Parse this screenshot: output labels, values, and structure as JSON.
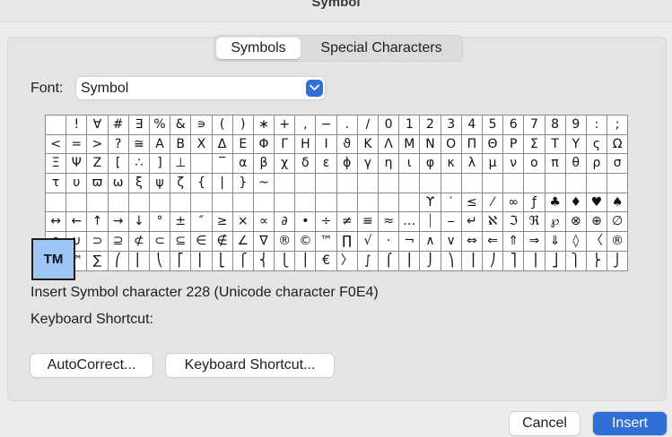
{
  "window": {
    "title": "Symbol"
  },
  "tabs": [
    {
      "label": "Symbols",
      "active": true
    },
    {
      "label": "Special Characters",
      "active": false
    }
  ],
  "font": {
    "label": "Font:",
    "value": "Symbol"
  },
  "grid": {
    "rows": [
      [
        "",
        "!",
        "∀",
        "#",
        "∃",
        "%",
        "&",
        "∍",
        "(",
        ")",
        "∗",
        "+",
        ",",
        "−",
        ".",
        "/",
        "0",
        "1",
        "2",
        "3",
        "4",
        "5",
        "6",
        "7",
        "8",
        "9",
        ":",
        ";"
      ],
      [
        "<",
        "=",
        ">",
        "?",
        "≅",
        "Α",
        "Β",
        "Χ",
        "Δ",
        "Ε",
        "Φ",
        "Γ",
        "Η",
        "Ι",
        "ϑ",
        "Κ",
        "Λ",
        "Μ",
        "Ν",
        "Ο",
        "Π",
        "Θ",
        "Ρ",
        "Σ",
        "Τ",
        "Υ",
        "ς",
        "Ω"
      ],
      [
        "Ξ",
        "Ψ",
        "Ζ",
        "[",
        "∴",
        "]",
        "⊥",
        "",
        "‾",
        "α",
        "β",
        "χ",
        "δ",
        "ε",
        "ϕ",
        "γ",
        "η",
        "ι",
        "φ",
        "κ",
        "λ",
        "μ",
        "ν",
        "ο",
        "π",
        "θ",
        "ρ",
        "σ"
      ],
      [
        "τ",
        "υ",
        "ϖ",
        "ω",
        "ξ",
        "ψ",
        "ζ",
        "{",
        "|",
        "}",
        "~",
        "",
        "",
        "",
        "",
        "",
        "",
        "",
        "",
        "",
        "",
        "",
        "",
        "",
        "",
        "",
        "",
        ""
      ],
      [
        "",
        "",
        "",
        "",
        "",
        "",
        "",
        "",
        "",
        "",
        "",
        "",
        "",
        "",
        "",
        "",
        "",
        "",
        "ϒ",
        "′",
        "≤",
        "⁄",
        "∞",
        "ƒ",
        "♣",
        "♦",
        "♥",
        "♠"
      ],
      [
        "↔",
        "←",
        "↑",
        "→",
        "↓",
        "°",
        "±",
        "″",
        "≥",
        "×",
        "∝",
        "∂",
        "•",
        "÷",
        "≠",
        "≡",
        "≈",
        "…",
        "⏐",
        "⎯",
        "↵",
        "ℵ",
        "ℑ",
        "ℜ",
        "℘",
        "⊗",
        "⊕",
        "∅"
      ],
      [
        "∩",
        "∪",
        "⊃",
        "⊇",
        "⊄",
        "⊂",
        "⊆",
        "∈",
        "∉",
        "∠",
        "∇",
        "®",
        "©",
        "™",
        "∏",
        "√",
        "⋅",
        "¬",
        "∧",
        "∨",
        "⇔",
        "⇐",
        "⇑",
        "⇒",
        "⇓",
        "◊",
        "〈",
        "®"
      ],
      [
        "©",
        "™",
        "∑",
        "⎛",
        "⎜",
        "⎝",
        "⎡",
        "⎢",
        "⎣",
        "⎧",
        "⎨",
        "⎩",
        "⎪",
        "€",
        "〉",
        "∫",
        "⌠",
        "⎮",
        "⌡",
        "⎞",
        "⎟",
        "⎠",
        "⎤",
        "⎥",
        "⎦",
        "⎫",
        "⎬",
        "⎭"
      ]
    ]
  },
  "selected": {
    "glyph": "TM"
  },
  "info": {
    "description": "Insert Symbol character 228  (Unicode character F0E4)",
    "shortcut_label": "Keyboard Shortcut:"
  },
  "buttons": {
    "autocorrect": "AutoCorrect...",
    "keyboard_shortcut": "Keyboard Shortcut...",
    "cancel": "Cancel",
    "insert": "Insert"
  }
}
